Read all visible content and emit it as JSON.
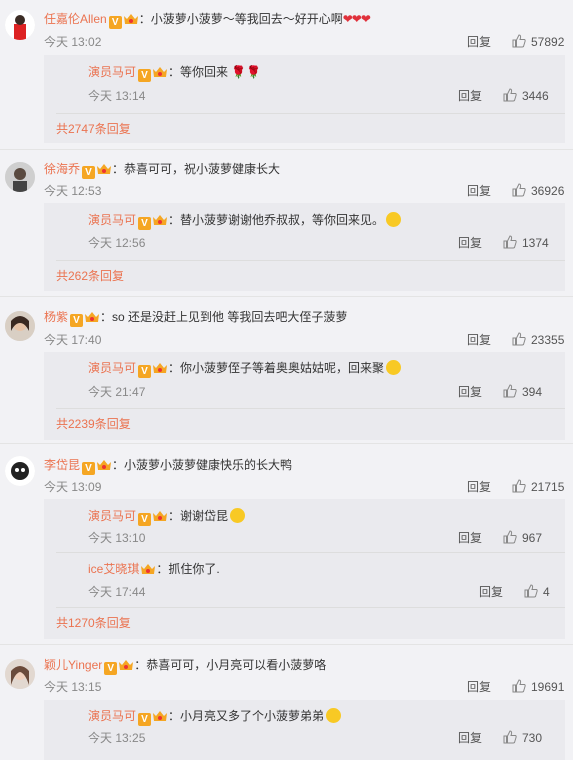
{
  "comments": [
    {
      "user": "任嘉伦Allen",
      "text": "小菠萝小菠萝～等我回去～好开心啊",
      "tail": "❤❤❤",
      "time": "今天 13:02",
      "reply": "回复",
      "likes": "57892",
      "replies": [
        {
          "user": "演员马可",
          "text": "等你回来 ",
          "tail": "🌹🌹",
          "time": "今天 13:14",
          "reply": "回复",
          "likes": "3446"
        }
      ],
      "more": "共2747条回复"
    },
    {
      "user": "徐海乔",
      "text": "恭喜可可，祝小菠萝健康长大",
      "time": "今天 12:53",
      "reply": "回复",
      "likes": "36926",
      "replies": [
        {
          "user": "演员马可",
          "text": "替小菠萝谢谢他乔叔叔，等你回来见。",
          "time": "今天 12:56",
          "reply": "回复",
          "likes": "1374"
        }
      ],
      "more": "共262条回复"
    },
    {
      "user": "杨紫",
      "text": "so 还是没赶上见到他 等我回去吧大侄子菠萝",
      "time": "今天 17:40",
      "reply": "回复",
      "likes": "23355",
      "replies": [
        {
          "user": "演员马可",
          "text": "你小菠萝侄子等着奥奥姑姑呢，回来聚",
          "time": "今天 21:47",
          "reply": "回复",
          "likes": "394"
        }
      ],
      "more": "共2239条回复"
    },
    {
      "user": "李岱昆",
      "text": "小菠萝小菠萝健康快乐的长大鸭",
      "time": "今天 13:09",
      "reply": "回复",
      "likes": "21715",
      "replies": [
        {
          "user": "演员马可",
          "text": "谢谢岱昆",
          "time": "今天 13:10",
          "reply": "回复",
          "likes": "967"
        },
        {
          "user": "ice艾晓琪",
          "text": "抓住你了.",
          "time": "今天 17:44",
          "reply": "回复",
          "likes": "4"
        }
      ],
      "more": "共1270条回复"
    },
    {
      "user": "颖儿Yinger",
      "text": "恭喜可可，小月亮可以看小菠萝咯",
      "time": "今天 13:15",
      "reply": "回复",
      "likes": "19691",
      "replies": [
        {
          "user": "演员马可",
          "text": "小月亮又多了个小菠萝弟弟",
          "time": "今天 13:25",
          "reply": "回复",
          "likes": "730"
        }
      ]
    }
  ],
  "colon": "：",
  "v_badge": "V",
  "colors": {
    "name": "#eb7350",
    "background": "#f2f2f5",
    "sub_background": "#eaeaee"
  }
}
